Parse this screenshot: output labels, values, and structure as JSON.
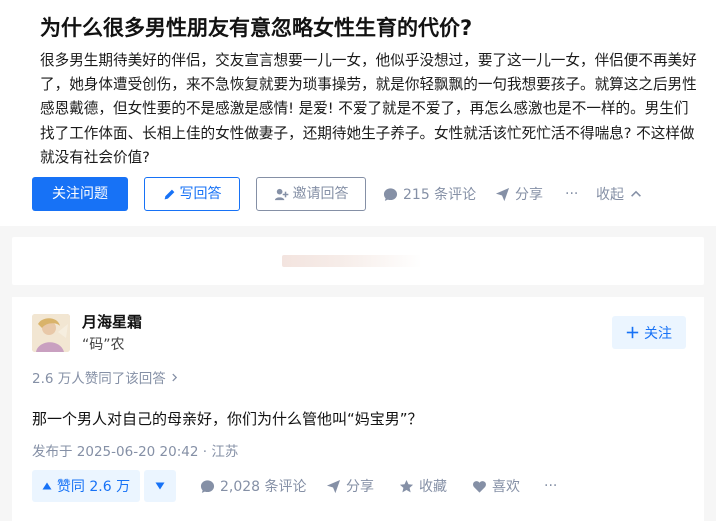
{
  "question": {
    "title": "为什么很多男性朋友有意忽略女性生育的代价?",
    "body": "很多男生期待美好的伴侣，交友宣言想要一儿一女，他似乎没想过，要了这一儿一女，伴侣便不再美好了，她身体遭受创伤，来不急恢复就要为琐事操劳，就是你轻飘飘的一句我想要孩子。就算这之后男性感恩戴德，但女性要的不是感激是感情! 是爱! 不爱了就是不爱了，再怎么感激也是不一样的。男生们找了工作体面、长相上佳的女性做妻子，还期待她生子养子。女性就活该忙死忙活不得喘息? 不这样做就没有社会价值?",
    "actions": {
      "follow_label": "关注问题",
      "write_answer_label": "写回答",
      "invite_label": "邀请回答",
      "comments_label": "215 条评论",
      "share_label": "分享",
      "more_label": "···",
      "collapse_label": "收起"
    }
  },
  "answer": {
    "author": {
      "name": "月海星霜",
      "headline": "“码”农",
      "follow_label": "关注"
    },
    "upvote_summary": "2.6 万人赞同了该回答",
    "content": "那一个男人对自己的母亲好，你们为什么管他叫“妈宝男”？",
    "meta": "发布于 2025-06-20 20:42 · 江苏",
    "actions": {
      "upvote_label": "赞同 2.6 万",
      "comments_label": "2,028 条评论",
      "share_label": "分享",
      "collect_label": "收藏",
      "like_label": "喜欢",
      "more_label": "···"
    }
  },
  "colors": {
    "primary": "#1772f6",
    "muted": "#8590a6",
    "light_blue_bg": "#ebf5ff",
    "page_bg": "#f6f6f6"
  },
  "icons": {
    "write": "pencil-icon",
    "invite": "invite-user-icon",
    "comment": "comment-bubble-icon",
    "share": "paper-plane-icon",
    "collapse": "chevron-up-icon",
    "follow": "plus-icon",
    "upvote": "triangle-up-icon",
    "downvote": "triangle-down-icon",
    "collect": "star-icon",
    "like": "heart-icon",
    "summary_arrow": "chevron-right-icon"
  }
}
